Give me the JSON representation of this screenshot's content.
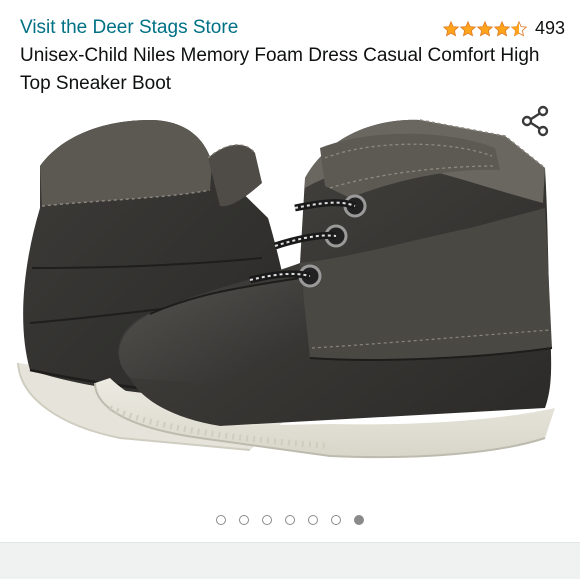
{
  "store": {
    "link_text": "Visit the Deer Stags Store"
  },
  "rating": {
    "stars": 4.5,
    "star_color": "#ffa41c",
    "review_count": "493"
  },
  "product": {
    "title": "Unisex-Child Niles Memory Foam Dress Casual Comfort High Top Sneaker Boot",
    "image_description_icon": "boot-photo"
  },
  "share": {
    "icon": "share-icon"
  },
  "carousel": {
    "total": 7,
    "active_index": 6
  },
  "colors": {
    "link": "#007185",
    "text": "#0f1111",
    "dot": "#8a8a8a"
  }
}
